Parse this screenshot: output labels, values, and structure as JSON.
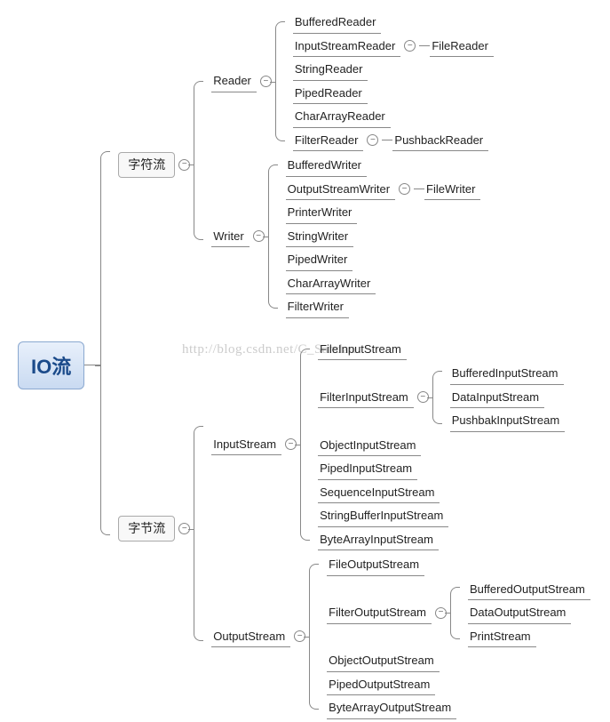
{
  "root": "IO流",
  "watermark": "http://blog.csdn.net/C_Sandan",
  "toggle": "−",
  "charStream": "字符流",
  "byteStream": "字节流",
  "reader": {
    "label": "Reader",
    "children": {
      "bufferedReader": "BufferedReader",
      "inputStreamReader": "InputStreamReader",
      "fileReader": "FileReader",
      "stringReader": "StringReader",
      "pipedReader": "PipedReader",
      "charArrayReader": "CharArrayReader",
      "filterReader": "FilterReader",
      "pushbackReader": "PushbackReader"
    }
  },
  "writer": {
    "label": "Writer",
    "children": {
      "bufferedWriter": "BufferedWriter",
      "outputStreamWriter": "OutputStreamWriter",
      "fileWriter": "FileWriter",
      "printerWriter": "PrinterWriter",
      "stringWriter": "StringWriter",
      "pipedWriter": "PipedWriter",
      "charArrayWriter": "CharArrayWriter",
      "filterWriter": "FilterWriter"
    }
  },
  "inputStream": {
    "label": "InputStream",
    "children": {
      "fileInputStream": "FileInputStream",
      "filterInputStream": "FilterInputStream",
      "bufferedInputStream": "BufferedInputStream",
      "dataInputStream": "DataInputStream",
      "pushbakInputStream": "PushbakInputStream",
      "objectInputStream": "ObjectInputStream",
      "pipedInputStream": "PipedInputStream",
      "sequenceInputStream": "SequenceInputStream",
      "stringBufferInputStream": "StringBufferInputStream",
      "byteArrayInputStream": "ByteArrayInputStream"
    }
  },
  "outputStream": {
    "label": "OutputStream",
    "children": {
      "fileOutputStream": "FileOutputStream",
      "filterOutputStream": "FilterOutputStream",
      "bufferedOutputStream": "BufferedOutputStream",
      "dataOutputStream": "DataOutputStream",
      "printStream": "PrintStream",
      "objectOutputStream": "ObjectOutputStream",
      "pipedOutputStream": "PipedOutputStream",
      "byteArrayOutputStream": "ByteArrayOutputStream"
    }
  }
}
